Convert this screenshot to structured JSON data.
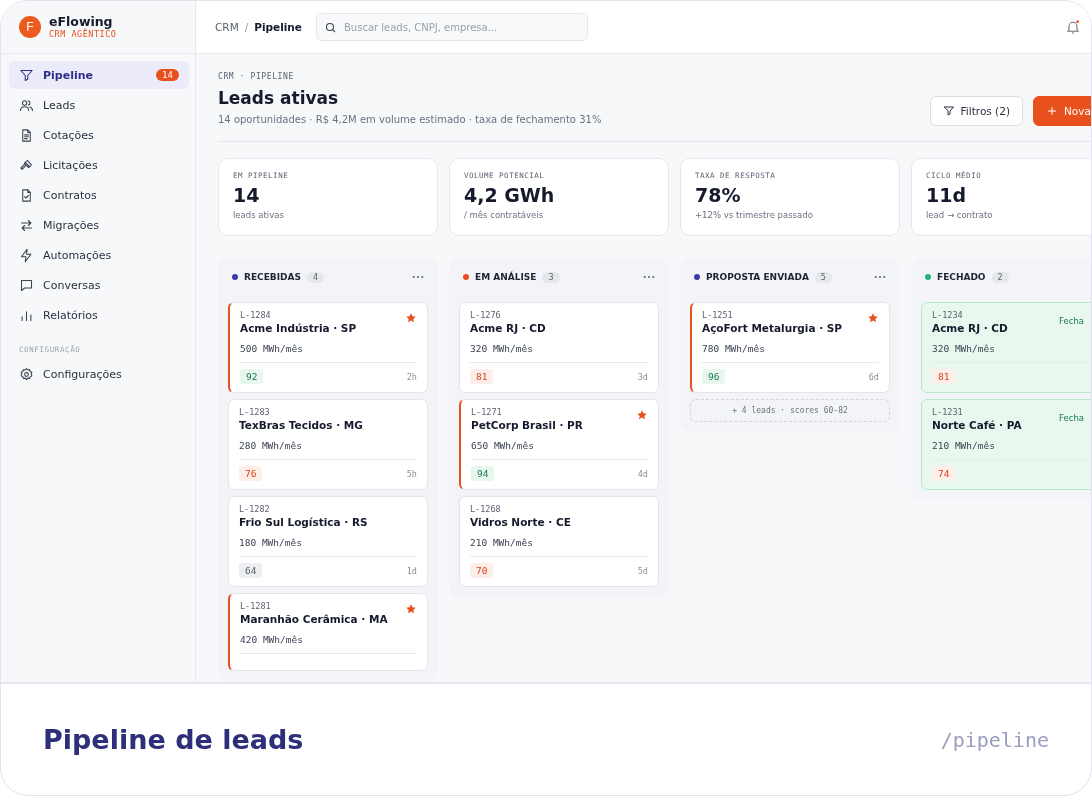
{
  "brand": {
    "mark": "F",
    "name": "eFlowing",
    "tagline": "CRM AGÊNTICO"
  },
  "sidebar": {
    "items": [
      {
        "kind": "funnel",
        "label": "Pipeline",
        "badge": "14",
        "selected": true
      },
      {
        "kind": "users",
        "label": "Leads",
        "selected": false
      },
      {
        "kind": "document",
        "label": "Cotações",
        "selected": false
      },
      {
        "kind": "gavel",
        "label": "Licitações",
        "selected": false
      },
      {
        "kind": "contract",
        "label": "Contratos",
        "selected": false
      },
      {
        "kind": "arrows",
        "label": "Migrações",
        "selected": false
      },
      {
        "kind": "bolt",
        "label": "Automações",
        "selected": false
      },
      {
        "kind": "chat",
        "label": "Conversas",
        "selected": false
      },
      {
        "kind": "bars",
        "label": "Relatórios",
        "selected": false
      }
    ],
    "section": "CONFIGURAÇÃO",
    "settings_items": [
      {
        "kind": "gear",
        "label": "Configurações",
        "selected": false
      }
    ]
  },
  "topbar": {
    "breadcrumb": [
      {
        "label": "CRM",
        "current": false
      },
      {
        "label": "Pipeline",
        "current": true
      }
    ],
    "separator": "/",
    "search": {
      "placeholder": "Buscar leads, CNPJ, empresa..."
    },
    "notifications": {
      "unread": true
    }
  },
  "header": {
    "eyebrow": "CRM · PIPELINE",
    "title": "Leads ativas",
    "summary": "14 oportunidades · R$ 4,2M em volume estimado · taxa de fechamento 31%",
    "buttons": [
      {
        "kind": "filter",
        "label": "Filtros (2)"
      },
      {
        "kind": "primary",
        "label": "Nova"
      }
    ]
  },
  "stats": [
    {
      "label": "EM PIPELINE",
      "value": "14",
      "note": "leads ativas"
    },
    {
      "label": "VOLUME POTENCIAL",
      "value": "4,2 GWh",
      "note": "/ mês contratáveis"
    },
    {
      "label": "TAXA DE RESPOSTA",
      "value": "78%",
      "note": "+12% vs trimestre passado"
    },
    {
      "label": "CICLO MÉDIO",
      "value": "11d",
      "note": "lead → contrato"
    }
  ],
  "columns": [
    {
      "name": "RECEBIDAS",
      "count": "4",
      "color": "#3b3ba8",
      "kind": "open",
      "cards": [
        {
          "id": "L-1284",
          "name": "Acme Indústria · SP",
          "volume": "500 MWh/mês",
          "score": {
            "value": "92",
            "kind": "good"
          },
          "age": "2h",
          "flagged": true,
          "starred": true
        },
        {
          "id": "L-1283",
          "name": "TexBras Tecidos · MG",
          "volume": "280 MWh/mês",
          "score": {
            "value": "76",
            "kind": "warn"
          },
          "age": "5h",
          "flagged": false,
          "starred": false
        },
        {
          "id": "L-1282",
          "name": "Frio Sul Logística · RS",
          "volume": "180 MWh/mês",
          "score": {
            "value": "64",
            "kind": "neutral"
          },
          "age": "1d",
          "flagged": false,
          "starred": false
        },
        {
          "id": "L-1281",
          "name": "Maranhão Cerâmica · MA",
          "volume": "420 MWh/mês",
          "flagged": true,
          "starred": true
        }
      ]
    },
    {
      "name": "EM ANÁLISE",
      "count": "3",
      "color": "#e8501e",
      "kind": "open",
      "cards": [
        {
          "id": "L-1276",
          "name": "Acme RJ · CD",
          "volume": "320 MWh/mês",
          "score": {
            "value": "81",
            "kind": "warn"
          },
          "age": "3d",
          "flagged": false,
          "starred": false
        },
        {
          "id": "L-1271",
          "name": "PetCorp Brasil · PR",
          "volume": "650 MWh/mês",
          "score": {
            "value": "94",
            "kind": "good"
          },
          "age": "4d",
          "flagged": true,
          "starred": true
        },
        {
          "id": "L-1268",
          "name": "Vidros Norte · CE",
          "volume": "210 MWh/mês",
          "score": {
            "value": "70",
            "kind": "warn"
          },
          "age": "5d",
          "flagged": false,
          "starred": false
        }
      ]
    },
    {
      "name": "PROPOSTA ENVIADA",
      "count": "5",
      "color": "#3b3ba8",
      "kind": "open",
      "cards": [
        {
          "id": "L-1251",
          "name": "AçoFort Metalurgia · SP",
          "volume": "780 MWh/mês",
          "score": {
            "value": "96",
            "kind": "good"
          },
          "age": "6d",
          "flagged": true,
          "starred": true
        }
      ],
      "more": "+ 4 leads · scores 60-82"
    },
    {
      "name": "FECHADO",
      "count": "2",
      "color": "#1fb57a",
      "kind": "won",
      "cards": [
        {
          "id": "L-1234",
          "name": "Acme RJ · CD",
          "volume": "320 MWh/mês",
          "score": {
            "value": "81",
            "kind": "warn"
          },
          "tag": "Fecha",
          "flagged": false,
          "starred": false
        },
        {
          "id": "L-1231",
          "name": "Norte Café · PA",
          "volume": "210 MWh/mês",
          "score": {
            "value": "74",
            "kind": "warn"
          },
          "tag": "Fecha",
          "flagged": false,
          "starred": false
        }
      ]
    }
  ],
  "caption": {
    "title": "Pipeline de leads",
    "path": "/pipeline"
  }
}
